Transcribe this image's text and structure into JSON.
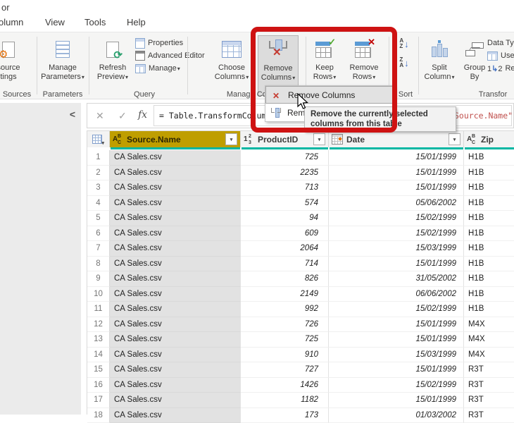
{
  "title_fragment": "or",
  "tabs": [
    "olumn",
    "View",
    "Tools",
    "Help"
  ],
  "ribbon": {
    "data_source": {
      "line1": "source",
      "line2": "tings"
    },
    "group_sources": "Sources",
    "manage_parameters": {
      "line1": "Manage",
      "line2": "Parameters"
    },
    "group_parameters": "Parameters",
    "refresh_preview": {
      "line1": "Refresh",
      "line2": "Preview"
    },
    "properties": "Properties",
    "advanced_editor": "Advanced Editor",
    "manage": "Manage",
    "group_query": "Query",
    "choose_columns": {
      "line1": "Choose",
      "line2": "Columns"
    },
    "remove_columns": {
      "line1": "Remove",
      "line2": "Columns"
    },
    "group_manage_columns": "Manage Columns",
    "keep_rows": {
      "line1": "Keep",
      "line2": "Rows"
    },
    "remove_rows": {
      "line1": "Remove",
      "line2": "Rows"
    },
    "group_sort": "Sort",
    "split_column": {
      "line1": "Split",
      "line2": "Column"
    },
    "group_by": {
      "line1": "Group",
      "line2": "By"
    },
    "data_type_label": "Data Type",
    "use_first_rows_label": "Use F",
    "replace_values_label": "Repla",
    "replace_one": "1",
    "replace_two": "2",
    "group_transform": "Transfor"
  },
  "formula_bar": {
    "formula_prefix": "= Table.TransformColumnTyp",
    "formula_string_fragment": "Source.Name\""
  },
  "menu": {
    "items": [
      {
        "label": "Remove Columns"
      },
      {
        "label": "Remove Other Columns"
      }
    ]
  },
  "tooltip": {
    "line1": "Remove the currently selected",
    "line2": "columns from this table"
  },
  "table": {
    "columns": [
      {
        "name": "Source.Name",
        "type": "text",
        "selected": true
      },
      {
        "name": "ProductID",
        "type": "number"
      },
      {
        "name": "Date",
        "type": "date"
      },
      {
        "name": "Zip",
        "type": "text"
      }
    ],
    "rows": [
      [
        "1",
        "CA Sales.csv",
        "725",
        "15/01/1999",
        "H1B"
      ],
      [
        "2",
        "CA Sales.csv",
        "2235",
        "15/01/1999",
        "H1B"
      ],
      [
        "3",
        "CA Sales.csv",
        "713",
        "15/01/1999",
        "H1B"
      ],
      [
        "4",
        "CA Sales.csv",
        "574",
        "05/06/2002",
        "H1B"
      ],
      [
        "5",
        "CA Sales.csv",
        "94",
        "15/02/1999",
        "H1B"
      ],
      [
        "6",
        "CA Sales.csv",
        "609",
        "15/02/1999",
        "H1B"
      ],
      [
        "7",
        "CA Sales.csv",
        "2064",
        "15/03/1999",
        "H1B"
      ],
      [
        "8",
        "CA Sales.csv",
        "714",
        "15/01/1999",
        "H1B"
      ],
      [
        "9",
        "CA Sales.csv",
        "826",
        "31/05/2002",
        "H1B"
      ],
      [
        "10",
        "CA Sales.csv",
        "2149",
        "06/06/2002",
        "H1B"
      ],
      [
        "11",
        "CA Sales.csv",
        "992",
        "15/02/1999",
        "H1B"
      ],
      [
        "12",
        "CA Sales.csv",
        "726",
        "15/01/1999",
        "M4X"
      ],
      [
        "13",
        "CA Sales.csv",
        "725",
        "15/01/1999",
        "M4X"
      ],
      [
        "14",
        "CA Sales.csv",
        "910",
        "15/03/1999",
        "M4X"
      ],
      [
        "15",
        "CA Sales.csv",
        "727",
        "15/01/1999",
        "R3T"
      ],
      [
        "16",
        "CA Sales.csv",
        "1426",
        "15/02/1999",
        "R3T"
      ],
      [
        "17",
        "CA Sales.csv",
        "1182",
        "15/01/1999",
        "R3T"
      ],
      [
        "18",
        "CA Sales.csv",
        "173",
        "01/03/2002",
        "R3T"
      ]
    ]
  },
  "icons": {
    "dropdown": "▾",
    "gear": "⚙",
    "refresh": "⟳",
    "fx": "fx",
    "clear": "✕",
    "check": "✓",
    "chevron_left": "<",
    "sort_arrow": "↓",
    "filter_arrow": "▾",
    "cross": "✕",
    "replace_arrow": "↳",
    "abc": {
      "a": "A",
      "b": "B",
      "c": "C"
    },
    "num": {
      "a": "1",
      "b": "2",
      "c": "3"
    }
  },
  "colors": {
    "annotation_red": "#ce1212",
    "selected_header_gold": "#bf9e00",
    "quality_bar_teal": "#00b7a3",
    "selected_cells_gray": "#e2e2e2"
  }
}
